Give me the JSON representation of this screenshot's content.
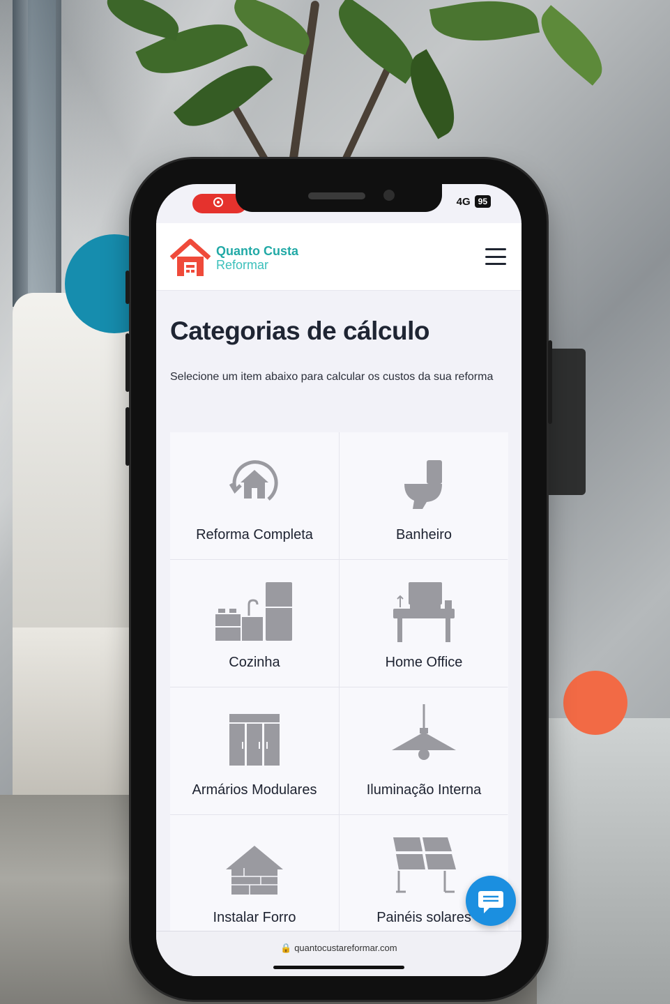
{
  "status_bar": {
    "network": "4G",
    "battery": "95"
  },
  "header": {
    "logo_line1": "Quanto Custa",
    "logo_line2": "Reformar"
  },
  "main": {
    "title": "Categorias de cálculo",
    "subtitle": "Selecione um item abaixo para calcular os custos da sua reforma"
  },
  "categories": [
    {
      "label": "Reforma Completa",
      "icon": "house-renovation-icon"
    },
    {
      "label": "Banheiro",
      "icon": "toilet-icon"
    },
    {
      "label": "Cozinha",
      "icon": "kitchen-icon"
    },
    {
      "label": "Home Office",
      "icon": "desk-icon"
    },
    {
      "label": "Armários Modulares",
      "icon": "wardrobe-icon"
    },
    {
      "label": "Iluminação Interna",
      "icon": "pendant-lamp-icon"
    },
    {
      "label": "Instalar Forro",
      "icon": "house-ceiling-icon"
    },
    {
      "label": "Painéis solares",
      "icon": "solar-panel-icon"
    }
  ],
  "browser": {
    "url": "quantocustareformar.com"
  },
  "colors": {
    "brand_teal": "#21a9a6",
    "logo_red": "#ef4a3a",
    "icon_gray": "#9a9aa0",
    "chat_blue": "#1b8fe0",
    "accent_blue": "#168dae",
    "accent_orange": "#f26a45"
  }
}
